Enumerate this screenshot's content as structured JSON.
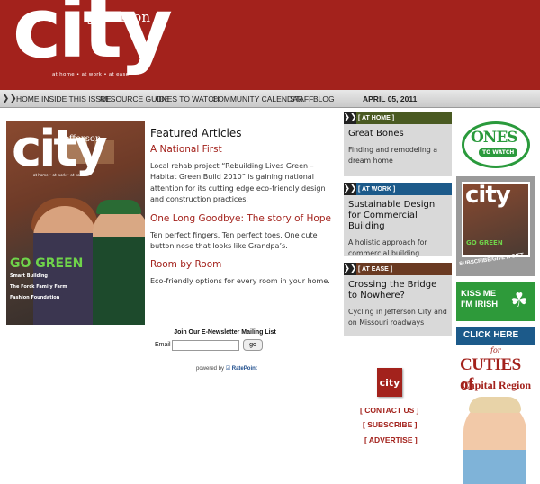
{
  "header": {
    "logo_city": "city",
    "logo_jefferson": "Jefferson",
    "logo_tagline": "at home • at work • at ease",
    "brand_color": "#a3221c"
  },
  "nav": {
    "items": [
      "HOME",
      "INSIDE THIS ISSUE",
      "RESOURCE GUIDE",
      "ONES TO WATCH",
      "COMMUNITY CALENDAR",
      "STAFF",
      "BLOG"
    ],
    "date": "APRIL 05, 2011"
  },
  "cover": {
    "city": "city",
    "jefferson": "Jefferson",
    "tagline": "at home • at work • at ease",
    "headline": "GO GREEN",
    "lines": [
      "Smart Building",
      "The Forck Family Farm",
      "Fashion Foundation"
    ]
  },
  "featured": {
    "heading": "Featured Articles",
    "articles": [
      {
        "title": "A National First",
        "desc": "Local rehab project “Rebuilding Lives Green – Habitat Green Build 2010” is gaining national attention for its cutting edge eco-friendly design and construction practices."
      },
      {
        "title": "One Long Goodbye: The story of Hope",
        "desc": "Ten perfect fingers. Ten perfect toes. One cute button nose that looks like Grandpa’s."
      },
      {
        "title": "Room by Room",
        "desc": "Eco-friendly options for every room in your home."
      }
    ]
  },
  "newsletter": {
    "title": "Join Our E-Newsletter Mailing List",
    "email_label": "Email",
    "email_value": "",
    "go_label": "go",
    "powered_by": "powered by",
    "ratepoint": "RatePoint"
  },
  "sections": [
    {
      "category": "[ AT HOME ]",
      "title": "Great Bones",
      "desc": "Finding and remodeling a dream home",
      "color": "#4a5a22"
    },
    {
      "category": "[ AT WORK ]",
      "title": "Sustainable Design for Commercial Building",
      "desc": "A holistic approach for commercial building",
      "color": "#1c5a8a"
    },
    {
      "category": "[ AT EASE ]",
      "title": "Crossing the Bridge to Nowhere?",
      "desc": "Cycling in Jefferson City and on Missouri roadways",
      "color": "#6a3a22"
    }
  ],
  "contact": {
    "badge": "city",
    "links": [
      "[ CONTACT US ]",
      "[ SUBSCRIBE ]",
      "[ ADVERTISE ]"
    ]
  },
  "ads": {
    "ones_title": "ONES",
    "ones_sub": "TO WATCH",
    "sub_city": "city",
    "sub_go": "GO GREEN",
    "sub_text": "SUBSCRIBE/GIVE A GIFT",
    "irish_line1": "KISS ME",
    "irish_line2": "I’M IRISH",
    "clickhere": "CLICK HERE",
    "cuties_for": "for",
    "cuties_title": "CUTIES of",
    "cuties_sub": "Capital Region"
  }
}
